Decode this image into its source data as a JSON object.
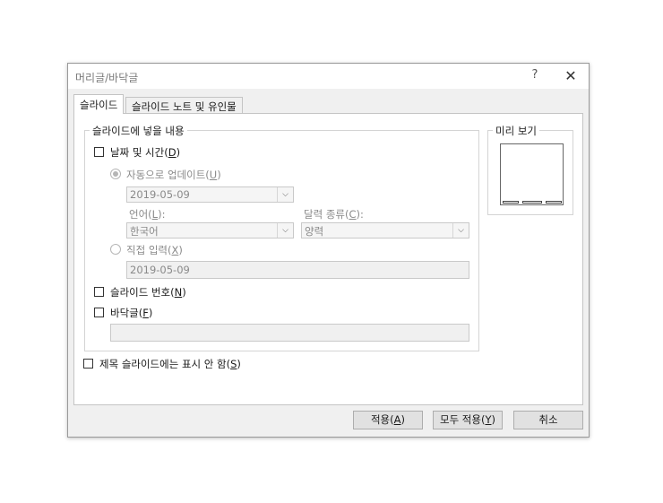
{
  "dialog": {
    "title": "머리글/바닥글",
    "help_label": "?",
    "close_label": "✕"
  },
  "tabs": [
    {
      "label": "슬라이드"
    },
    {
      "label": "슬라이드 노트 및 유인물"
    }
  ],
  "content_group": {
    "legend": "슬라이드에 넣을 내용",
    "date_time": {
      "label": "날짜 및 시간",
      "accel": "D",
      "checked": false
    },
    "auto_update": {
      "label": "자동으로 업데이트",
      "accel": "U",
      "selected": true,
      "date_value": "2019-05-09"
    },
    "language": {
      "label": "언어",
      "accel": "L",
      "value": "한국어"
    },
    "calendar": {
      "label": "달력 종류",
      "accel": "C",
      "value": "양력"
    },
    "fixed": {
      "label": "직접 입력",
      "accel": "X",
      "selected": false,
      "value": "2019-05-09"
    },
    "slide_number": {
      "label": "슬라이드 번호",
      "accel": "N",
      "checked": false
    },
    "footer": {
      "label": "바닥글",
      "accel": "F",
      "checked": false,
      "value": ""
    }
  },
  "dont_show_title": {
    "label": "제목 슬라이드에는 표시 안 함",
    "accel": "S",
    "checked": false
  },
  "preview": {
    "legend": "미리 보기"
  },
  "buttons": {
    "apply": {
      "label": "적용",
      "accel": "A"
    },
    "apply_all": {
      "label": "모두 적용",
      "accel": "Y"
    },
    "cancel": {
      "label": "취소"
    }
  }
}
